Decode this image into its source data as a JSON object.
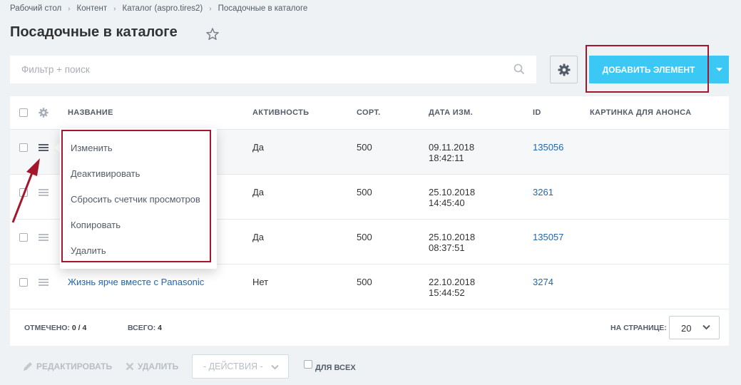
{
  "breadcrumbs": [
    "Рабочий стол",
    "Контент",
    "Каталог (aspro.tires2)",
    "Посадочные в каталоге"
  ],
  "page_title": "Посадочные в каталоге",
  "filter": {
    "placeholder": "Фильтр + поиск"
  },
  "toolbar": {
    "add_label": "ДОБАВИТЬ ЭЛЕМЕНТ"
  },
  "grid": {
    "columns": [
      "НАЗВАНИЕ",
      "АКТИВНОСТЬ",
      "СОРТ.",
      "ДАТА ИЗМ.",
      "ID",
      "КАРТИНКА ДЛЯ АНОНСА"
    ],
    "rows": [
      {
        "name": "",
        "active": "Да",
        "sort": "500",
        "date": "09.11.2018",
        "time": "18:42:11",
        "id": "135056"
      },
      {
        "name": "",
        "active": "Да",
        "sort": "500",
        "date": "25.10.2018",
        "time": "14:45:40",
        "id": "3261"
      },
      {
        "name": "",
        "active": "Да",
        "sort": "500",
        "date": "25.10.2018",
        "time": "08:37:51",
        "id": "135057"
      },
      {
        "name": "Жизнь ярче вместе с Panasonic",
        "active": "Нет",
        "sort": "500",
        "date": "22.10.2018",
        "time": "15:44:52",
        "id": "3274"
      }
    ]
  },
  "footer": {
    "selected_label": "ОТМЕЧЕНО:",
    "selected_value": "0 / 4",
    "total_label": "ВСЕГО:",
    "total_value": "4",
    "per_page_label": "НА СТРАНИЦЕ:",
    "per_page_value": "20"
  },
  "actions": {
    "edit": "РЕДАКТИРОВАТЬ",
    "delete": "УДАЛИТЬ",
    "select": "- ДЕЙСТВИЯ -",
    "for_all": "ДЛЯ ВСЕХ"
  },
  "context_menu": [
    "Изменить",
    "Деактивировать",
    "Сбросить счетчик просмотров",
    "Копировать",
    "Удалить"
  ],
  "colors": {
    "accent": "#3bc8f5",
    "highlight": "#a3162c",
    "link": "#2067b0"
  }
}
